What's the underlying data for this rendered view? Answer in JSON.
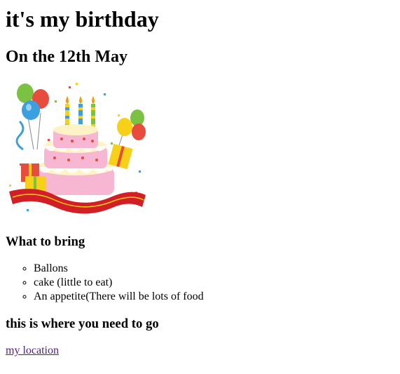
{
  "title": "it's my birthday",
  "date_heading": "On the 12th May",
  "image": {
    "icon": "birthday-cake-icon",
    "colors": {
      "cake_pink": "#f7b6d2",
      "cake_cream": "#fdf3c4",
      "ribbon_red": "#d21f26",
      "candle_yellow": "#f7d117",
      "candle_blue": "#3aa0e0",
      "candle_green": "#7cc242"
    }
  },
  "bring": {
    "heading": "What to bring",
    "items": [
      "Ballons",
      "cake (little to eat)",
      "An appetite(There will be lots of food"
    ]
  },
  "location": {
    "heading": "this is where you need to go",
    "link_text": "my location",
    "link_color": "#551a8b"
  }
}
